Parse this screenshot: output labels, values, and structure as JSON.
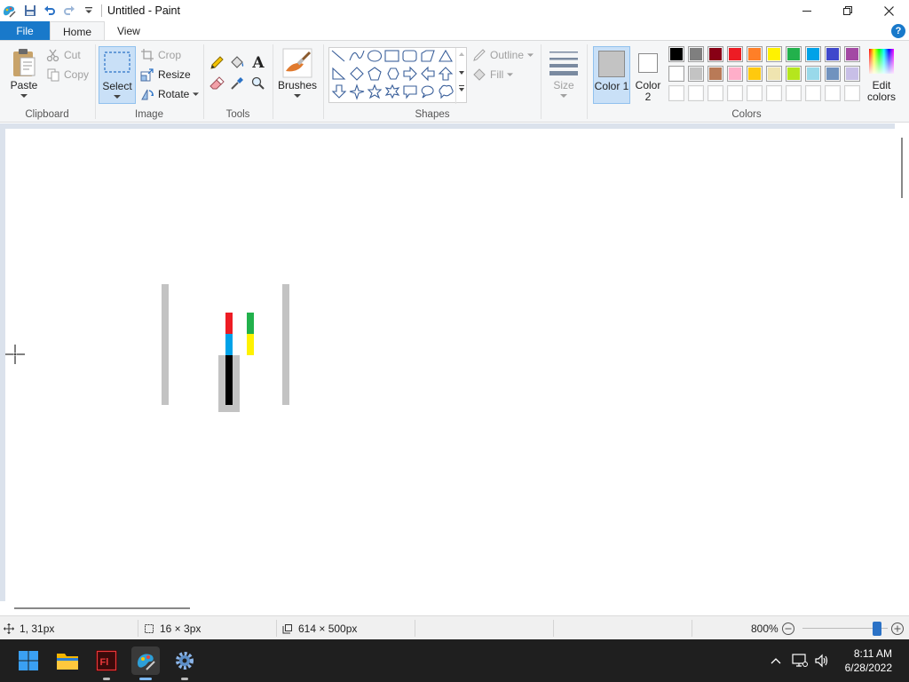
{
  "window": {
    "title": "Untitled - Paint"
  },
  "tabs": {
    "file": "File",
    "home": "Home",
    "view": "View",
    "help": "?"
  },
  "clipboard": {
    "paste": "Paste",
    "cut": "Cut",
    "copy": "Copy",
    "label": "Clipboard"
  },
  "image": {
    "select": "Select",
    "crop": "Crop",
    "resize": "Resize",
    "rotate": "Rotate",
    "label": "Image"
  },
  "tools": {
    "label": "Tools",
    "text_tool": "A"
  },
  "brushes": {
    "label": "Brushes"
  },
  "shapes": {
    "outline": "Outline",
    "fill": "Fill",
    "label": "Shapes"
  },
  "size": {
    "label": "Size"
  },
  "colors": {
    "color1_label": "Color 1",
    "color2_label": "Color 2",
    "edit_label": "Edit colors",
    "label": "Colors",
    "color1": "#c3c3c3",
    "color2": "#ffffff",
    "row1": [
      "#000000",
      "#7f7f7f",
      "#880015",
      "#ed1c24",
      "#ff7f27",
      "#fff200",
      "#22b14c",
      "#00a2e8",
      "#3f48cc",
      "#a349a4"
    ],
    "row2": [
      "#ffffff",
      "#c3c3c3",
      "#b97a57",
      "#ffaec9",
      "#ffc90e",
      "#efe4b0",
      "#b5e61d",
      "#99d9ea",
      "#7092be",
      "#c8bfe7"
    ],
    "row3": [
      "#ffffff",
      "#ffffff",
      "#ffffff",
      "#ffffff",
      "#ffffff",
      "#ffffff",
      "#ffffff",
      "#ffffff",
      "#ffffff",
      "#ffffff"
    ]
  },
  "status": {
    "cursor_pos": "1, 31px",
    "selection_size": "16 × 3px",
    "image_size": "614 × 500px",
    "zoom": "800%",
    "zoom_slider_level": 0.92
  },
  "taskbar": {
    "time": "8:11 AM",
    "date": "6/28/2022"
  }
}
